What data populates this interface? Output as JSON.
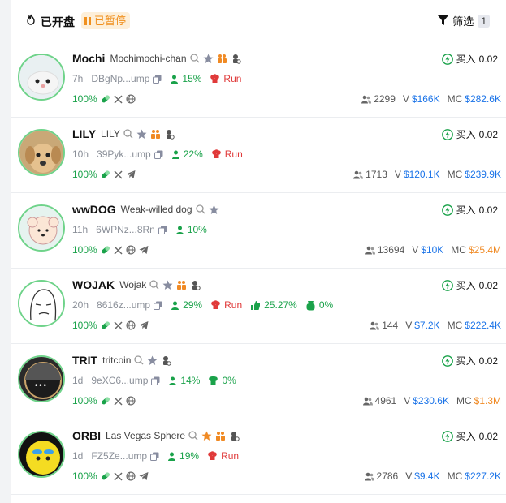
{
  "header": {
    "title": "已开盘",
    "paused_label": "已暂停",
    "filter_label": "筛选",
    "filter_count": "1"
  },
  "colors": {
    "accent_green": "#1aa24a",
    "blue": "#1a73e8",
    "orange": "#f08a24",
    "red": "#e03a3a"
  },
  "buy_label": "买入",
  "tokens": [
    {
      "symbol": "Mochi",
      "name": "Mochimochi-chan",
      "age": "7h",
      "address": "DBgNp...ump",
      "holder_pct": "15%",
      "extra": "Run",
      "progress": "100%",
      "buy_amount": "0.02",
      "holders": "2299",
      "volume_prefix": "V",
      "volume": "$166K",
      "mc_prefix": "MC",
      "mc": "$282.6K"
    },
    {
      "symbol": "LILY",
      "name": "LILY",
      "age": "10h",
      "address": "39Pyk...ump",
      "holder_pct": "22%",
      "extra": "Run",
      "progress": "100%",
      "buy_amount": "0.02",
      "holders": "1713",
      "volume_prefix": "V",
      "volume": "$120.1K",
      "mc_prefix": "MC",
      "mc": "$239.9K"
    },
    {
      "symbol": "wwDOG",
      "name": "Weak-willed dog",
      "age": "11h",
      "address": "6WPNz...8Rn",
      "holder_pct": "10%",
      "progress": "100%",
      "buy_amount": "0.02",
      "holders": "13694",
      "volume_prefix": "V",
      "volume": "$10K",
      "mc_prefix": "MC",
      "mc": "$25.4M"
    },
    {
      "symbol": "WOJAK",
      "name": "Wojak",
      "age": "20h",
      "address": "8616z...ump",
      "holder_pct": "29%",
      "extra": "Run",
      "extra2": "25.27%",
      "extra3": "0%",
      "progress": "100%",
      "buy_amount": "0.02",
      "holders": "144",
      "volume_prefix": "V",
      "volume": "$7.2K",
      "mc_prefix": "MC",
      "mc": "$222.4K"
    },
    {
      "symbol": "TRIT",
      "name": "tritcoin",
      "age": "1d",
      "address": "9eXC6...ump",
      "holder_pct": "14%",
      "extra": "0%",
      "progress": "100%",
      "buy_amount": "0.02",
      "holders": "4961",
      "volume_prefix": "V",
      "volume": "$230.6K",
      "mc_prefix": "MC",
      "mc": "$1.3M"
    },
    {
      "symbol": "ORBI",
      "name": "Las Vegas Sphere",
      "age": "1d",
      "address": "FZ5Ze...ump",
      "holder_pct": "19%",
      "extra": "Run",
      "progress": "100%",
      "buy_amount": "0.02",
      "holders": "2786",
      "volume_prefix": "V",
      "volume": "$9.4K",
      "mc_prefix": "MC",
      "mc": "$227.2K"
    }
  ]
}
